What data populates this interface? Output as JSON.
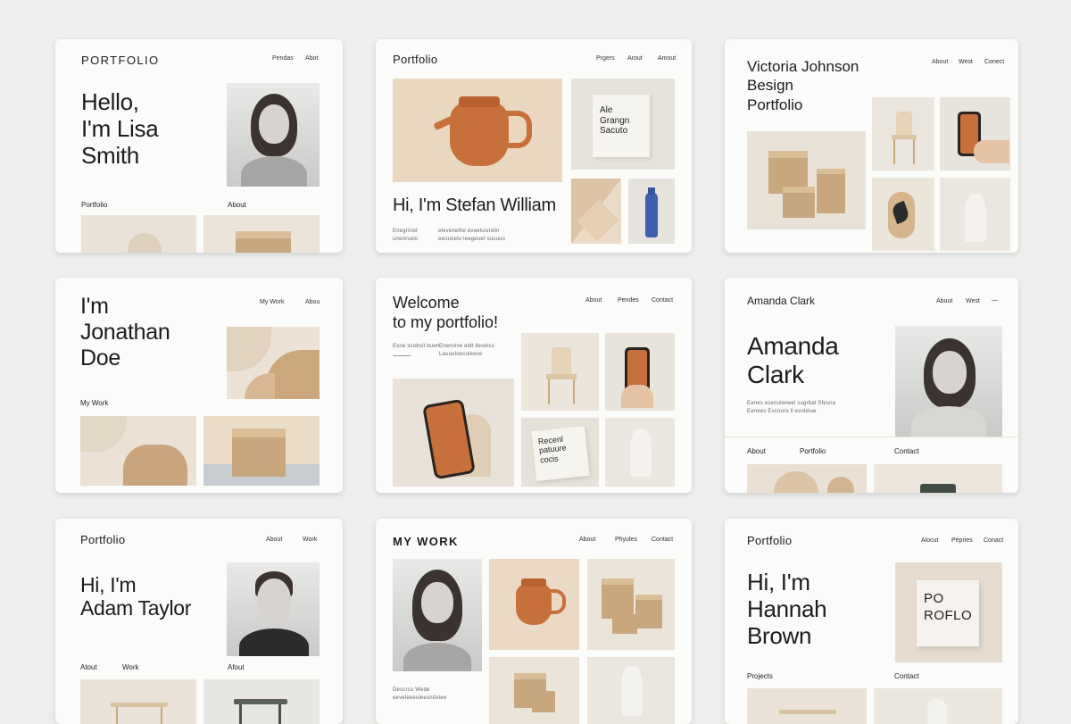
{
  "cards": {
    "c1": {
      "brand": "PORTFOLIO",
      "nav": [
        "Pendas",
        "Abot"
      ],
      "headline": [
        "Hello,",
        "I'm Lisa",
        "Smith"
      ],
      "labels": [
        "Portfolio",
        "About"
      ]
    },
    "c2": {
      "brand": "Portfolio",
      "nav": [
        "Prgers",
        "Arout",
        "Amout"
      ],
      "headline": "Hi, I'm Stefan William",
      "card_text": [
        "Ale",
        "Grangn",
        "Sacuto"
      ],
      "tiny_left": [
        "Enegrirod",
        "unenruelo"
      ],
      "tiny_right": [
        "elevenelhe eveelusnidin",
        "eeouoelu leegeuel suuuuo"
      ]
    },
    "c3": {
      "brand": [
        "Victoria Johnson",
        "Besign",
        "Portfolio"
      ],
      "nav": [
        "About",
        "West",
        "Conect"
      ]
    },
    "c4": {
      "headline": [
        "I'm",
        "Jonathan",
        "Doe"
      ],
      "nav": [
        "My Work",
        "Abou"
      ],
      "label": "My Work"
    },
    "c5": {
      "headline": [
        "Welcome",
        "to my portfolio!"
      ],
      "nav": [
        "About",
        "Pendes",
        "Contact"
      ],
      "tiny_left": "Esne scobsit buen",
      "tiny_right": [
        "Enenvive eldt llevelss",
        "Lauuuloeculeeve"
      ],
      "card_text": [
        "Recenl",
        "patuure",
        "cocis"
      ]
    },
    "c6": {
      "brand": "Amanda Clark",
      "nav": [
        "Abuut",
        "West",
        "—"
      ],
      "headline": [
        "Amanda",
        "Clark"
      ],
      "tiny": [
        "Eenes esenuleneel sugrbal Sfesna",
        "Eenees Escoura ll evolelue"
      ],
      "labels": [
        "About",
        "Portfolio",
        "Contact"
      ]
    },
    "c7": {
      "brand": "Portfolio",
      "nav": [
        "About",
        "Work"
      ],
      "headline": [
        "Hi, I'm",
        "Adam Taylor"
      ],
      "labels": [
        "Atout",
        "Work",
        "Afout"
      ]
    },
    "c8": {
      "brand": "MY WORK",
      "nav": [
        "About",
        "Phyules",
        "Contact"
      ],
      "tiny": [
        "Descrcu Wede",
        "eeveleeeuleesnitelee"
      ]
    },
    "c9": {
      "brand": "Portfolio",
      "nav": [
        "Alocut",
        "Pépries",
        "Conact"
      ],
      "headline": [
        "Hi, I'm",
        "Hannah",
        "Brown"
      ],
      "card_text": [
        "PO",
        "ROFLO"
      ],
      "labels": [
        "Projects",
        "Contact"
      ]
    }
  },
  "colors": {
    "background": "#eeeeec",
    "card": "#fbfbf9",
    "terracotta": "#c8703c",
    "kraft": "#c8a77f",
    "sand": "#e6dccd",
    "blue": "#3e5fae"
  }
}
